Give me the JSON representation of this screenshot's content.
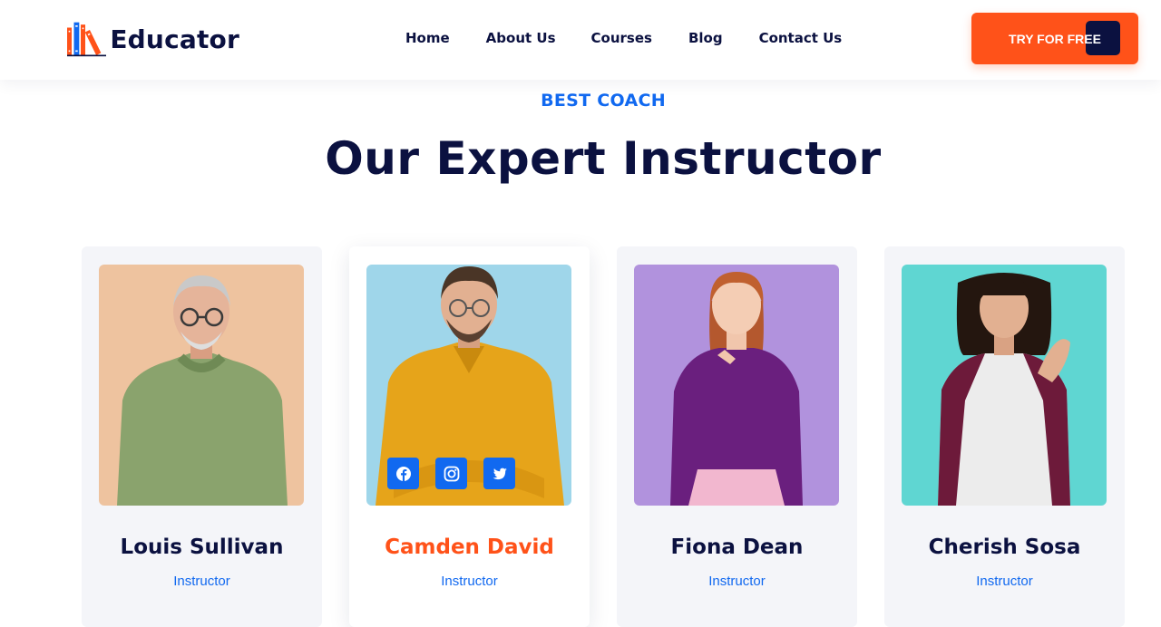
{
  "brand": {
    "name": "Educator"
  },
  "nav": {
    "items": [
      "Home",
      "About Us",
      "Courses",
      "Blog",
      "Contact Us"
    ]
  },
  "cta": {
    "label": "TRY FOR FREE"
  },
  "section": {
    "eyebrow": "BEST COACH",
    "title": "Our Expert Instructor"
  },
  "instructors": [
    {
      "name": "Louis Sullivan",
      "role": "Instructor"
    },
    {
      "name": "Camden David",
      "role": "Instructor"
    },
    {
      "name": "Fiona Dean",
      "role": "Instructor"
    },
    {
      "name": "Cherish Sosa",
      "role": "Instructor"
    }
  ],
  "socials": [
    "facebook-icon",
    "instagram-icon",
    "twitter-icon"
  ],
  "colors": {
    "accent": "#ff5219",
    "primary": "#1169f0",
    "navy": "#0b1140"
  }
}
